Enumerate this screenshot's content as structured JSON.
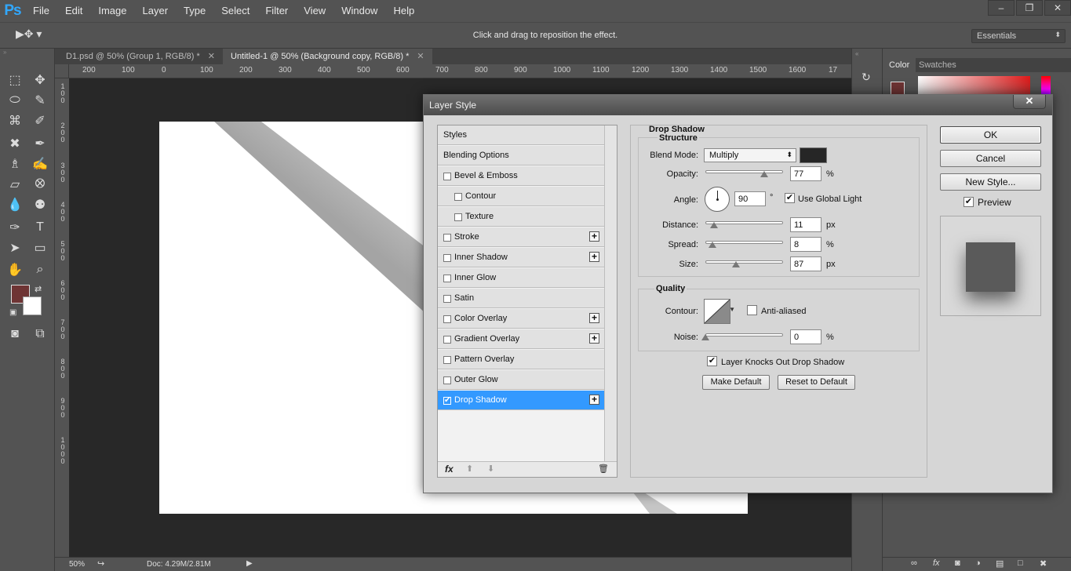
{
  "app": {
    "logo": "Ps",
    "menu": [
      "File",
      "Edit",
      "Image",
      "Layer",
      "Type",
      "Select",
      "Filter",
      "View",
      "Window",
      "Help"
    ],
    "window_controls": [
      "–",
      "❐",
      "✕"
    ]
  },
  "options_bar": {
    "hint": "Click and drag to reposition the effect.",
    "workspace": "Essentials"
  },
  "tabs": [
    {
      "label": "D1.psd @ 50% (Group 1, RGB/8) *",
      "close": "✕"
    },
    {
      "label": "Untitled-1 @ 50% (Background copy, RGB/8) *",
      "close": "✕"
    }
  ],
  "ruler_top": [
    "200",
    "100",
    "0",
    "100",
    "200",
    "300",
    "400",
    "500",
    "600",
    "700",
    "800",
    "900",
    "1000",
    "1100",
    "1200",
    "1300",
    "1400",
    "1500",
    "1600",
    "17"
  ],
  "ruler_left": [
    "1\n0\n0",
    "2\n0\n0",
    "3\n0\n0",
    "4\n0\n0",
    "5\n0\n0",
    "6\n0\n0",
    "7\n0\n0",
    "8\n0\n0",
    "9\n0\n0",
    "1\n0\n0\n0"
  ],
  "status": {
    "zoom": "50%",
    "doc": "Doc: 4.29M/2.81M"
  },
  "right_panel": {
    "tabs": [
      "Color",
      "Swatches"
    ]
  },
  "dialog": {
    "title": "Layer Style",
    "close": "✕",
    "styles": [
      {
        "label": "Styles",
        "checkbox": false,
        "plus": false,
        "indent": 0,
        "checked": false
      },
      {
        "label": "Blending Options",
        "checkbox": false,
        "plus": false,
        "indent": 0,
        "checked": false
      },
      {
        "label": "Bevel & Emboss",
        "checkbox": true,
        "plus": false,
        "indent": 0,
        "checked": false
      },
      {
        "label": "Contour",
        "checkbox": true,
        "plus": false,
        "indent": 1,
        "checked": false
      },
      {
        "label": "Texture",
        "checkbox": true,
        "plus": false,
        "indent": 1,
        "checked": false
      },
      {
        "label": "Stroke",
        "checkbox": true,
        "plus": true,
        "indent": 0,
        "checked": false
      },
      {
        "label": "Inner Shadow",
        "checkbox": true,
        "plus": true,
        "indent": 0,
        "checked": false
      },
      {
        "label": "Inner Glow",
        "checkbox": true,
        "plus": false,
        "indent": 0,
        "checked": false
      },
      {
        "label": "Satin",
        "checkbox": true,
        "plus": false,
        "indent": 0,
        "checked": false
      },
      {
        "label": "Color Overlay",
        "checkbox": true,
        "plus": true,
        "indent": 0,
        "checked": false
      },
      {
        "label": "Gradient Overlay",
        "checkbox": true,
        "plus": true,
        "indent": 0,
        "checked": false
      },
      {
        "label": "Pattern Overlay",
        "checkbox": true,
        "plus": false,
        "indent": 0,
        "checked": false
      },
      {
        "label": "Outer Glow",
        "checkbox": true,
        "plus": false,
        "indent": 0,
        "checked": false
      },
      {
        "label": "Drop Shadow",
        "checkbox": true,
        "plus": true,
        "indent": 0,
        "checked": true,
        "active": true
      }
    ],
    "footer": {
      "fx": "fx"
    },
    "section_title": "Drop Shadow",
    "structure": {
      "title": "Structure",
      "blend_mode_label": "Blend Mode:",
      "blend_mode": "Multiply",
      "shadow_color": "#262626",
      "opacity_label": "Opacity:",
      "opacity": "77",
      "opacity_unit": "%",
      "angle_label": "Angle:",
      "angle": "90",
      "angle_unit": "°",
      "use_global_light": "Use Global Light",
      "distance_label": "Distance:",
      "distance": "11",
      "distance_unit": "px",
      "spread_label": "Spread:",
      "spread": "8",
      "spread_unit": "%",
      "size_label": "Size:",
      "size": "87",
      "size_unit": "px"
    },
    "quality": {
      "title": "Quality",
      "contour_label": "Contour:",
      "anti_aliased": "Anti-aliased",
      "noise_label": "Noise:",
      "noise": "0",
      "noise_unit": "%"
    },
    "knocks_out": "Layer Knocks Out Drop Shadow",
    "make_default": "Make Default",
    "reset_default": "Reset to Default",
    "ok": "OK",
    "cancel": "Cancel",
    "new_style": "New Style...",
    "preview": "Preview"
  }
}
